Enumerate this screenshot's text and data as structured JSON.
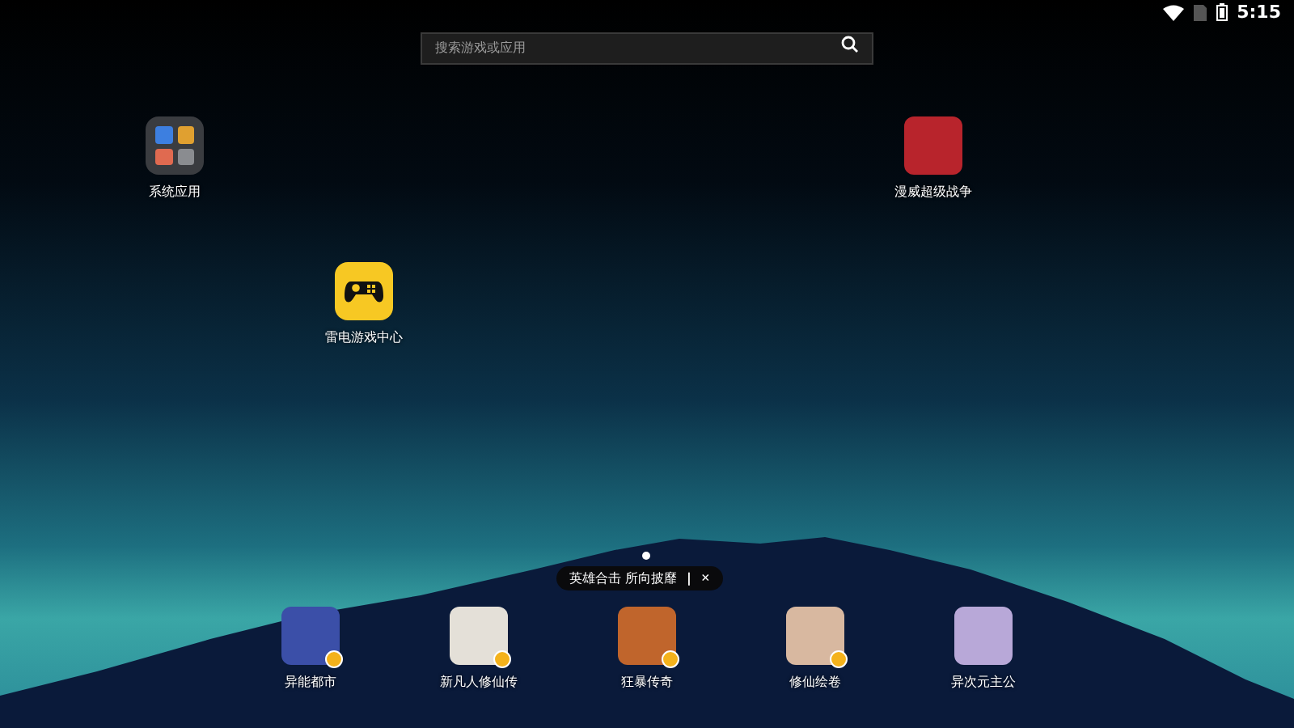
{
  "status_bar": {
    "time": "5:15"
  },
  "search": {
    "placeholder": "搜索游戏或应用"
  },
  "desktop": [
    {
      "label": "系统应用",
      "kind": "folder"
    },
    {
      "label": "漫威超级战争",
      "kind": "app"
    },
    {
      "label": "雷电游戏中心",
      "kind": "gamepad"
    }
  ],
  "pages": [
    {
      "selected": true
    }
  ],
  "promo": {
    "text": "英雄合击 所向披靡",
    "divider": "|",
    "close": "×"
  },
  "dock": [
    {
      "label": "异能都市",
      "badge": true,
      "color": "#3b4fa8"
    },
    {
      "label": "新凡人修仙传",
      "badge": true,
      "color": "#e4e0d8"
    },
    {
      "label": "狂暴传奇",
      "badge": true,
      "color": "#c0652c"
    },
    {
      "label": "修仙绘卷",
      "badge": true,
      "color": "#d8b8a0"
    },
    {
      "label": "异次元主公",
      "badge": false,
      "color": "#b8a8d8"
    }
  ]
}
